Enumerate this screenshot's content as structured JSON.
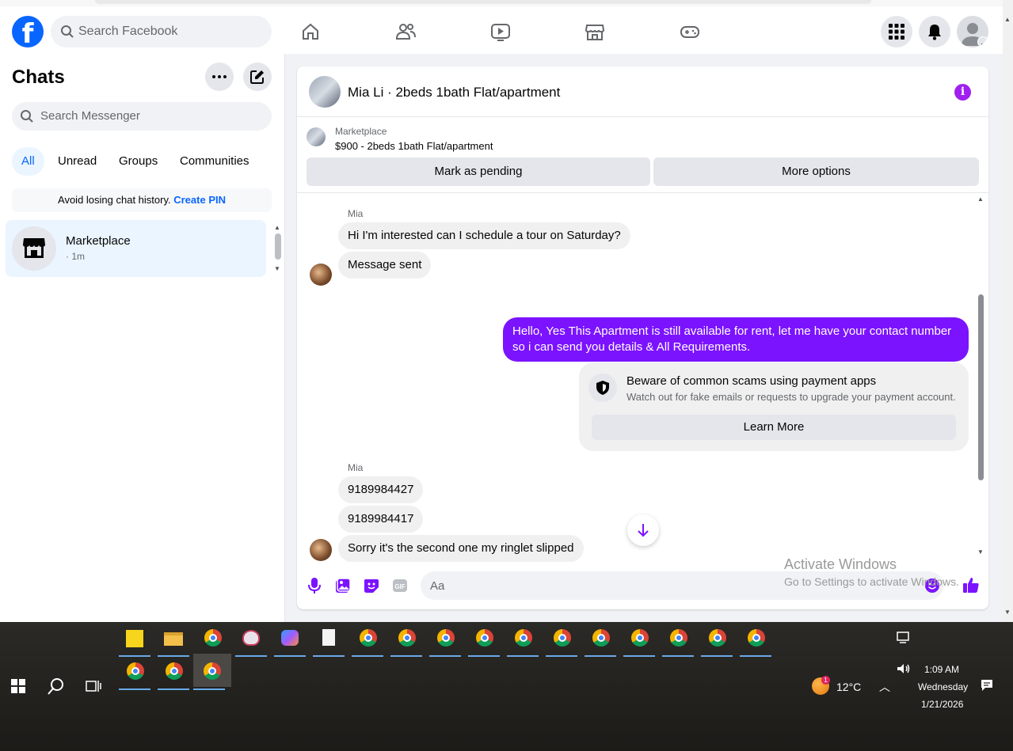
{
  "header": {
    "search_placeholder": "Search Facebook"
  },
  "sidebar": {
    "title": "Chats",
    "search_placeholder": "Search Messenger",
    "tabs": [
      {
        "label": "All",
        "active": true
      },
      {
        "label": "Unread"
      },
      {
        "label": "Groups"
      },
      {
        "label": "Communities"
      }
    ],
    "pin_notice": "Avoid losing chat history.",
    "pin_link": "Create PIN",
    "chats": [
      {
        "name": "Marketplace",
        "time": "· 1m"
      }
    ]
  },
  "conversation": {
    "title": "Mia Li · 2beds 1bath Flat/apartment",
    "marketplace_label": "Marketplace",
    "listing": "$900 - 2beds 1bath Flat/apartment",
    "mark_pending": "Mark as pending",
    "more_options": "More options",
    "messages": [
      {
        "sender": "Mia",
        "text": "Hi I'm interested can I schedule a tour on Saturday?"
      },
      {
        "text": "Message sent"
      },
      {
        "outgoing": true,
        "text": "Hello, Yes This Apartment is still available for rent, let me have your contact number so i can send you details & All Requirements."
      },
      {
        "sender": "Mia",
        "text": "9189984427"
      },
      {
        "text": "9189984417"
      },
      {
        "text": "Sorry it's the second one my ringlet slipped"
      }
    ],
    "scam_notice": {
      "title": "Beware of common scams using payment apps",
      "text": "Watch out for fake emails or requests to upgrade your payment account.",
      "button": "Learn More"
    },
    "composer_placeholder": "Aa"
  },
  "watermark": {
    "line1": "Activate Windows",
    "line2": "Go to Settings to activate Windows."
  },
  "taskbar": {
    "weather": "12°C",
    "weather_badge": "1",
    "time": "1:09 AM",
    "day": "Wednesday",
    "date": "1/21/2026"
  },
  "colors": {
    "facebook_blue": "#0866ff",
    "outgoing_bubble": "#7b13ff",
    "info_icon": "#a020f0"
  }
}
